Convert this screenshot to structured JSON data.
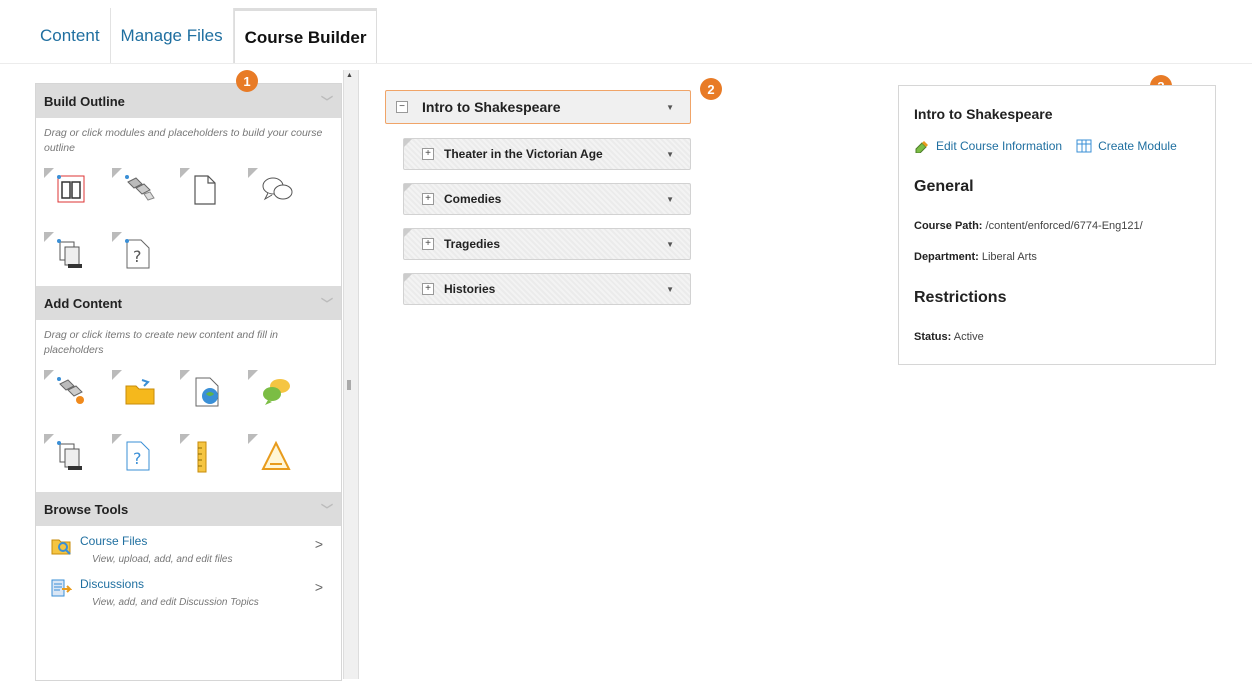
{
  "tabs": [
    {
      "label": "Content"
    },
    {
      "label": "Manage Files"
    },
    {
      "label": "Course Builder"
    }
  ],
  "badges": [
    "1",
    "2",
    "3"
  ],
  "build_outline": {
    "title": "Build Outline",
    "description": "Drag or click modules and placeholders to build your course outline",
    "icons": [
      "book-module-icon",
      "link-placeholder-icon",
      "file-placeholder-icon",
      "discussion-placeholder-icon",
      "copy-placeholder-icon",
      "quiz-placeholder-icon"
    ]
  },
  "add_content": {
    "title": "Add Content",
    "description": "Drag or click items to create new content and fill in placeholders",
    "icons": [
      "link-content-icon",
      "folder-content-icon",
      "web-content-icon",
      "discussion-content-icon",
      "copy-content-icon",
      "quiz-content-icon",
      "ruler-content-icon",
      "survey-content-icon"
    ]
  },
  "browse_tools": {
    "title": "Browse Tools",
    "items": [
      {
        "title": "Course Files",
        "desc": "View, upload, add, and edit files"
      },
      {
        "title": "Discussions",
        "desc": "View, add, and edit Discussion Topics"
      }
    ]
  },
  "outline": {
    "root": "Intro to Shakespeare",
    "modules": [
      "Theater in the Victorian Age",
      "Comedies",
      "Tragedies",
      "Histories"
    ]
  },
  "info": {
    "title": "Intro to Shakespeare",
    "edit_link": "Edit Course Information",
    "create_link": "Create Module",
    "general_heading": "General",
    "course_path_label": "Course Path:",
    "course_path_value": "/content/enforced/6774-Eng121/",
    "department_label": "Department:",
    "department_value": "Liberal Arts",
    "restrictions_heading": "Restrictions",
    "status_label": "Status:",
    "status_value": "Active"
  },
  "colors": {
    "accent": "#e87b26",
    "link": "#1f6fa0",
    "header_bg": "#dcdcdc"
  }
}
